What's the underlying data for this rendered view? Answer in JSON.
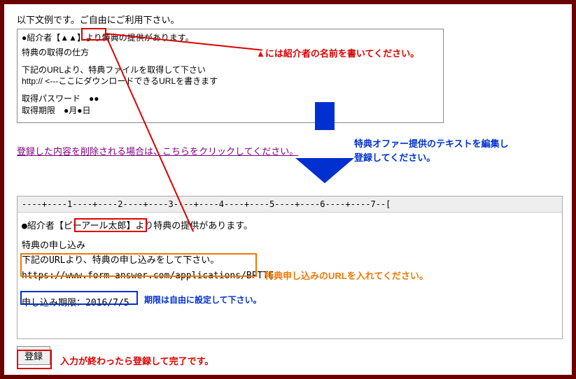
{
  "intro": "以下文例です。ご自由にご利用下さい。",
  "template": {
    "line1": "●紹介者【▲▲】より特典の提供があります。",
    "line2": "特典の取得の仕方",
    "line3": "下記のURLより、特典ファイルを取得して下さい",
    "line4": "http:// <---ここにダウンロードできるURLを書きます",
    "line5": "取得パスワード　●●",
    "line6": "取得期限　●月●日",
    "line7": "＿＿＿＿＿＿＿＿＿＿＿＿＿＿＿＿＿＿＿＿＿＿＿＿＿"
  },
  "annotations": {
    "red1": "▲には紹介者の名前を書いてください。",
    "blue1a": "特典オファー提供のテキストを編集し",
    "blue1b": "登録してください。",
    "orange": "特典申し込みのURLを入れてください。",
    "blue2": "期限は自由に設定して下さい。",
    "red2": "入力が終わったら登録して完了です。"
  },
  "deleteLink": "登録した内容を削除される場合は、こちらをクリックしてください。",
  "ruler": "----+----1----+----2----+----3----+----4----+----5----+----6----+----7--[",
  "example": {
    "line1a": "●紹介者【",
    "name": "ピーアール太郎",
    "line1b": "】より特典の提供があります。",
    "line2": "特典の申し込み",
    "line3": "下記のURLより、特典の申し込みをして下さい。",
    "line4": "https://www.form-answer.com/applications/BPTTE",
    "line5": "申し込み期限：2016/7/5"
  },
  "registerBtn": "登録"
}
